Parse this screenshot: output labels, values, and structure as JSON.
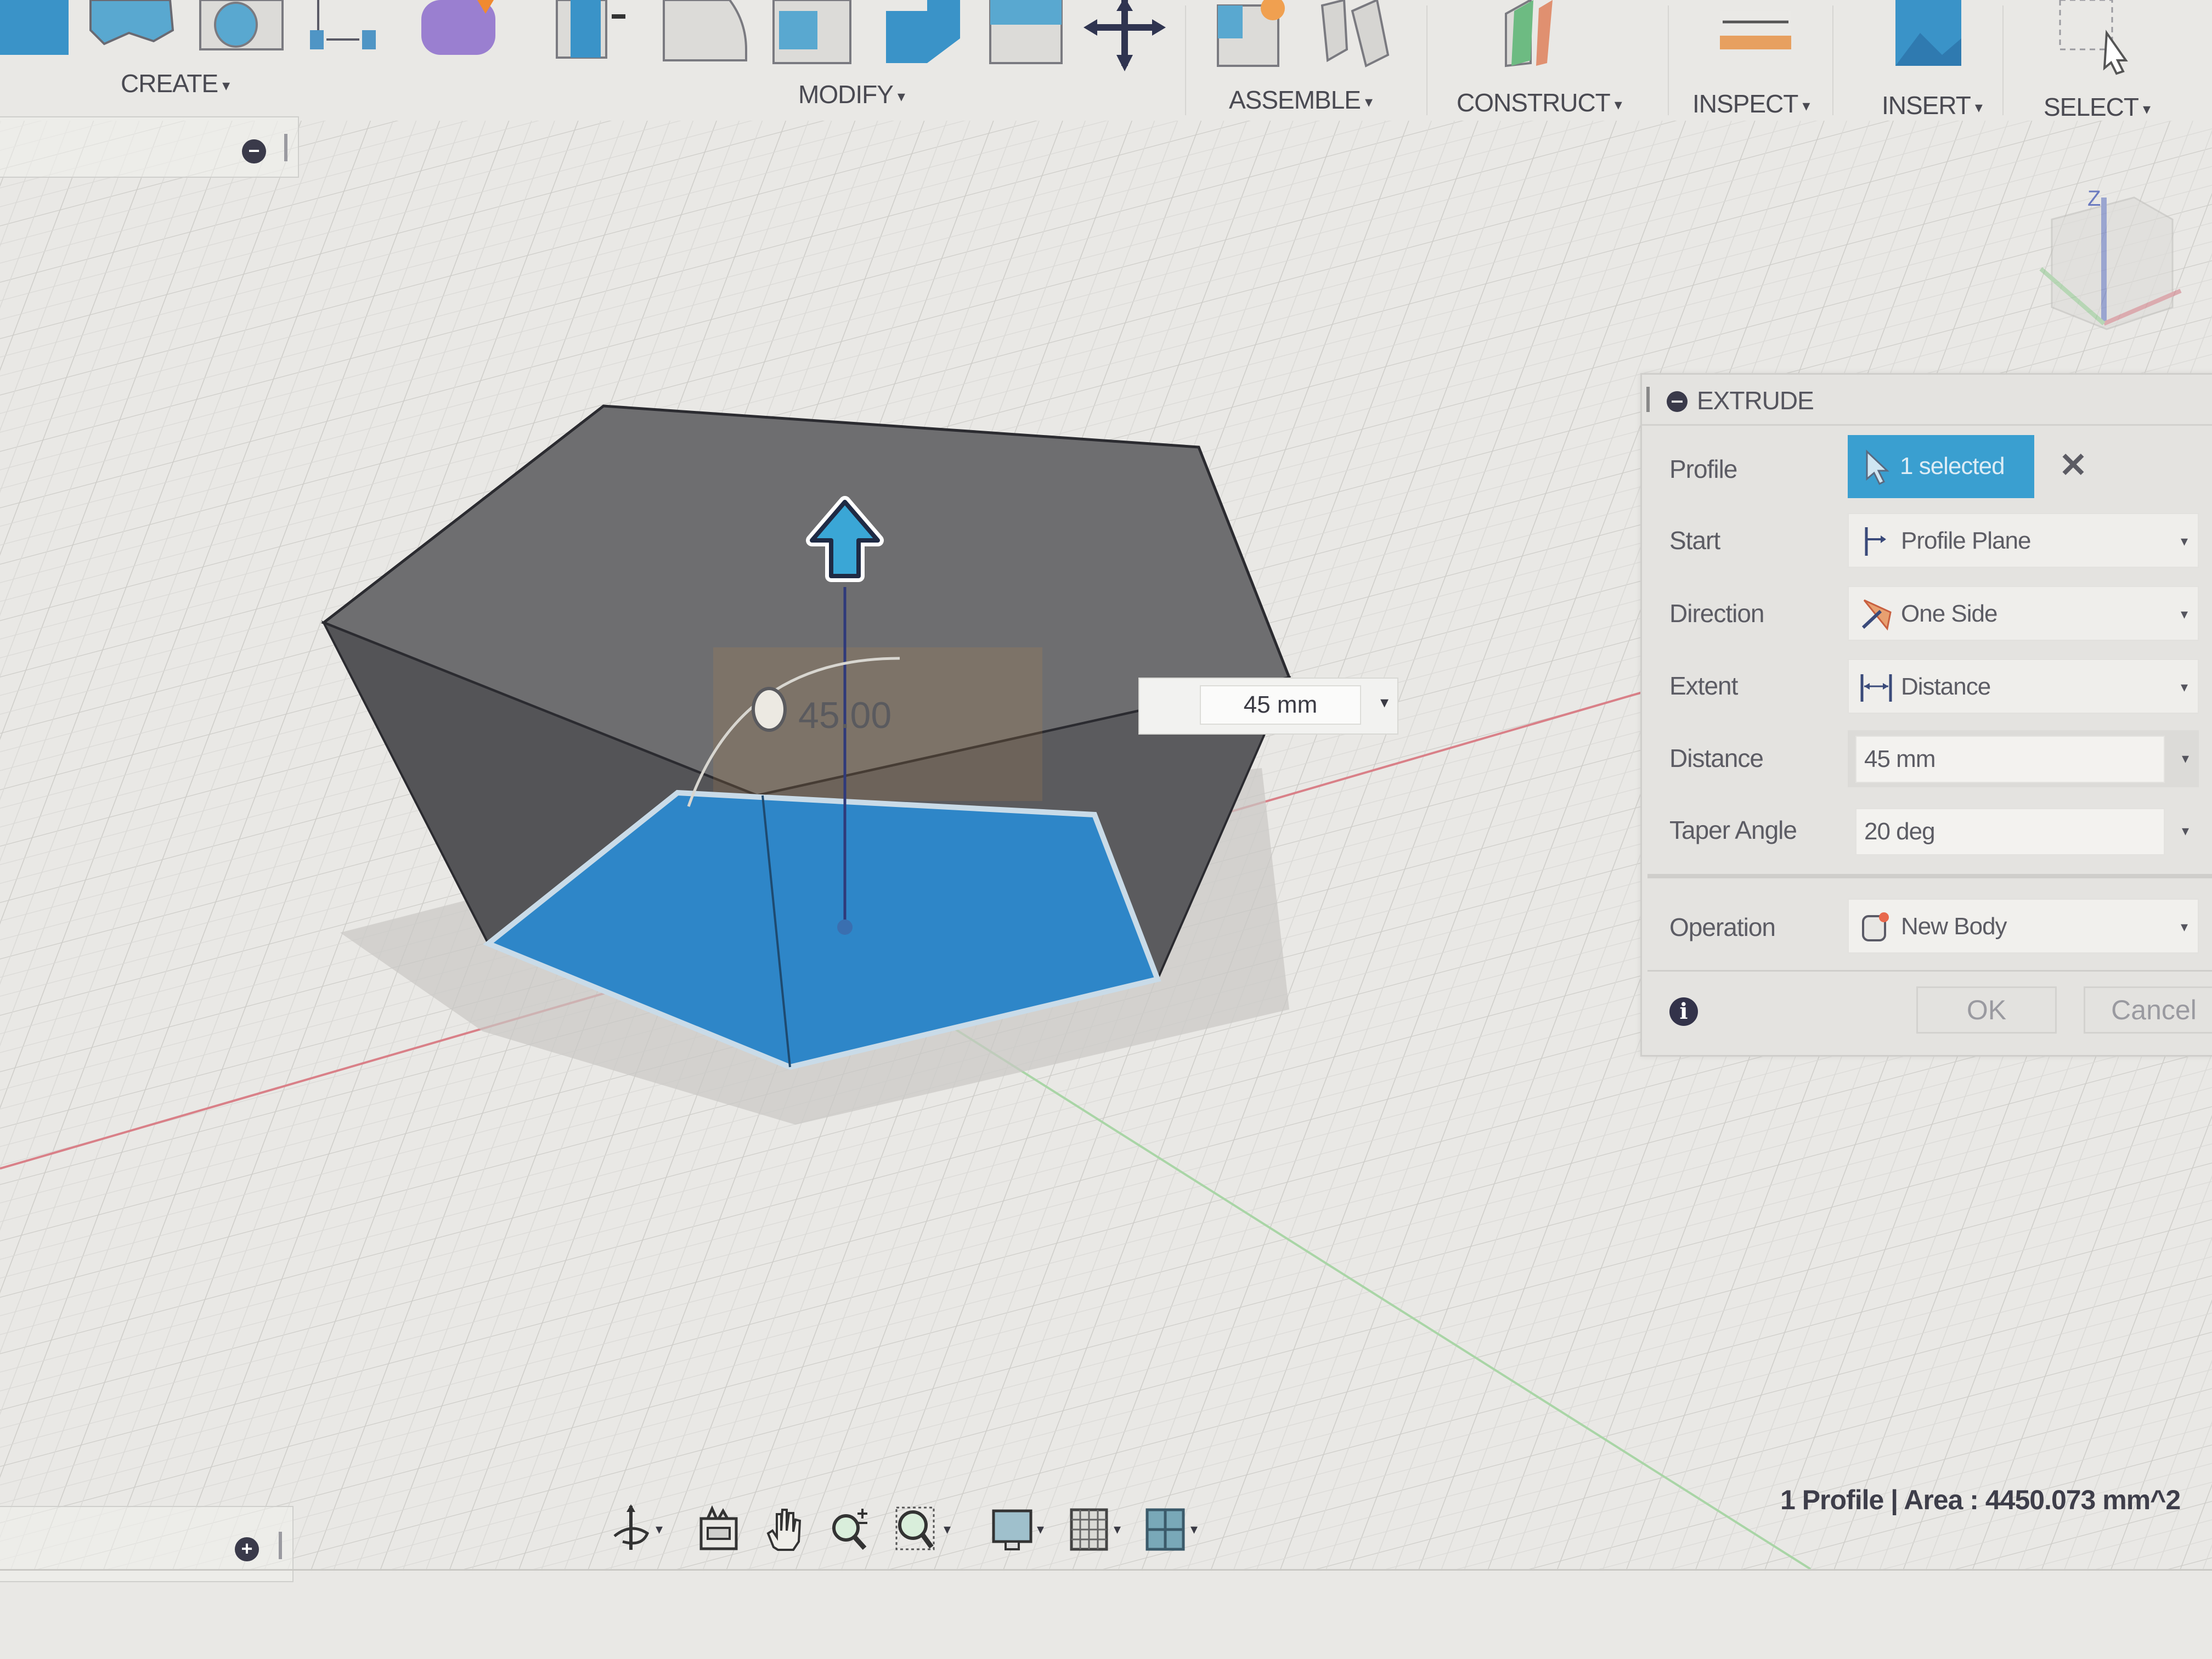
{
  "toolbar": {
    "groups": [
      {
        "label": "CREATE",
        "icon_names": [
          "new-component-icon",
          "extrude-icon",
          "revolve-icon",
          "sketch-dimension-icon",
          "form-icon"
        ]
      },
      {
        "label": "MODIFY",
        "icon_names": [
          "press-pull-icon",
          "fillet-icon",
          "shell-icon",
          "combine-icon",
          "split-body-icon",
          "move-icon"
        ]
      },
      {
        "label": "ASSEMBLE",
        "icon_names": [
          "new-component-icon",
          "joint-icon"
        ]
      },
      {
        "label": "CONSTRUCT",
        "icon_names": [
          "plane-icon"
        ]
      },
      {
        "label": "INSPECT",
        "icon_names": [
          "measure-icon"
        ]
      },
      {
        "label": "INSERT",
        "icon_names": [
          "insert-image-icon"
        ]
      },
      {
        "label": "SELECT",
        "icon_names": [
          "select-icon"
        ]
      }
    ],
    "caret": "▾"
  },
  "canvas": {
    "dimension_value": "45 mm",
    "angle_label": "45.00",
    "colors": {
      "body": "#6b6b6d",
      "body_dark": "#545456",
      "profile": "#2e86c8",
      "grid_line": "#c8c8c4",
      "x_axis": "#d97a80",
      "y_axis": "#8fc98f",
      "z_axis": "#5b6fc0",
      "manipulator": "#3aa6d6"
    }
  },
  "viewcube": {
    "label": "Z"
  },
  "dialog": {
    "title": "EXTRUDE",
    "rows": {
      "profile": {
        "label": "Profile",
        "value": "1 selected"
      },
      "start": {
        "label": "Start",
        "value": "Profile Plane"
      },
      "direction": {
        "label": "Direction",
        "value": "One Side"
      },
      "extent": {
        "label": "Extent",
        "value": "Distance"
      },
      "distance": {
        "label": "Distance",
        "value": "45 mm"
      },
      "taper": {
        "label": "Taper Angle",
        "value": "20 deg"
      },
      "operation": {
        "label": "Operation",
        "value": "New Body"
      }
    },
    "ok_label": "OK",
    "cancel_label": "Cancel",
    "info_glyph": "i",
    "clear_glyph": "✕"
  },
  "side_panels": {
    "top_btn": "−",
    "bottom_btn": "+"
  },
  "navbar": {
    "icons": [
      "orbit-icon",
      "look-at-icon",
      "pan-icon",
      "zoom-icon",
      "fit-icon",
      "display-settings-icon",
      "grid-settings-icon",
      "viewports-icon"
    ]
  },
  "status": {
    "text": "1 Profile | Area : 4450.073 mm^2"
  }
}
